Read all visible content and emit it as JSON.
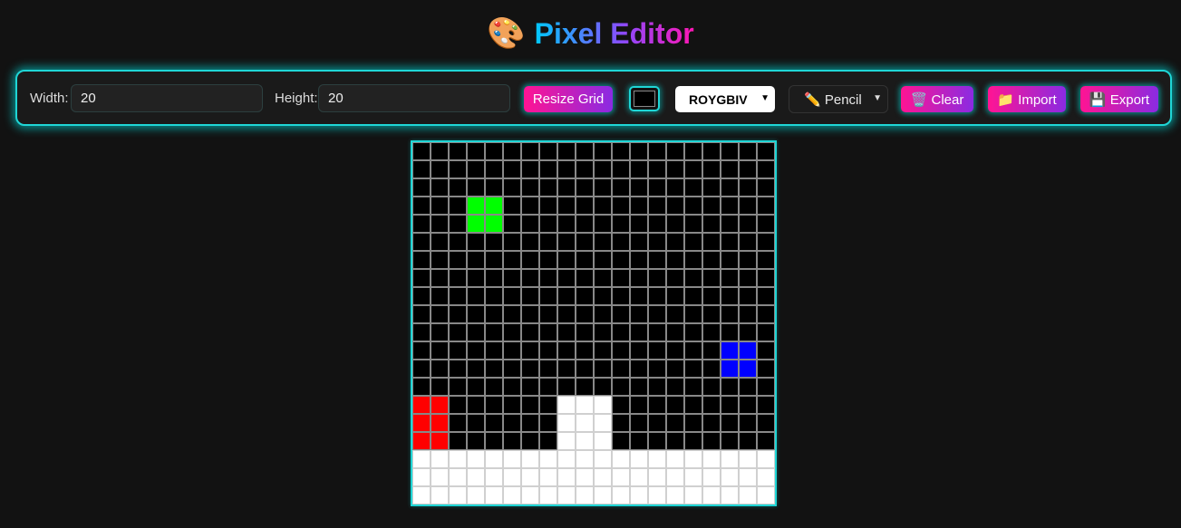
{
  "header": {
    "icon": "palette-icon",
    "emoji": "🎨",
    "title": "Pixel Editor"
  },
  "toolbar": {
    "width_label": "Width:",
    "width_value": "20",
    "height_label": "Height:",
    "height_value": "20",
    "resize_label": "Resize Grid",
    "current_color": "#000000",
    "palette_selected": "ROYGBIV",
    "tool_selected": "✏️ Pencil",
    "clear_label": "🗑️ Clear",
    "import_label": "📁 Import",
    "export_label": "💾 Export"
  },
  "colors": {
    "accent": "#1fd6d6",
    "button_start": "#ff1493",
    "button_end": "#8a2be2",
    "background": "#121212"
  },
  "grid": {
    "cols": 20,
    "rows": 20,
    "default_color": "#000000",
    "painted": [
      {
        "color": "#00ff00",
        "cells": [
          [
            3,
            3
          ],
          [
            3,
            4
          ],
          [
            4,
            3
          ],
          [
            4,
            4
          ]
        ]
      },
      {
        "color": "#0000ff",
        "cells": [
          [
            11,
            17
          ],
          [
            11,
            18
          ],
          [
            12,
            17
          ],
          [
            12,
            18
          ]
        ]
      },
      {
        "color": "#ff0000",
        "cells": [
          [
            14,
            0
          ],
          [
            14,
            1
          ],
          [
            15,
            0
          ],
          [
            15,
            1
          ],
          [
            16,
            0
          ],
          [
            16,
            1
          ]
        ]
      },
      {
        "color": "#ffffff",
        "cells": [
          [
            14,
            8
          ],
          [
            14,
            9
          ],
          [
            14,
            10
          ],
          [
            15,
            8
          ],
          [
            15,
            9
          ],
          [
            15,
            10
          ],
          [
            16,
            8
          ],
          [
            16,
            9
          ],
          [
            16,
            10
          ]
        ]
      },
      {
        "color": "#ffffff",
        "rows_full": [
          17,
          18,
          19
        ]
      }
    ]
  }
}
